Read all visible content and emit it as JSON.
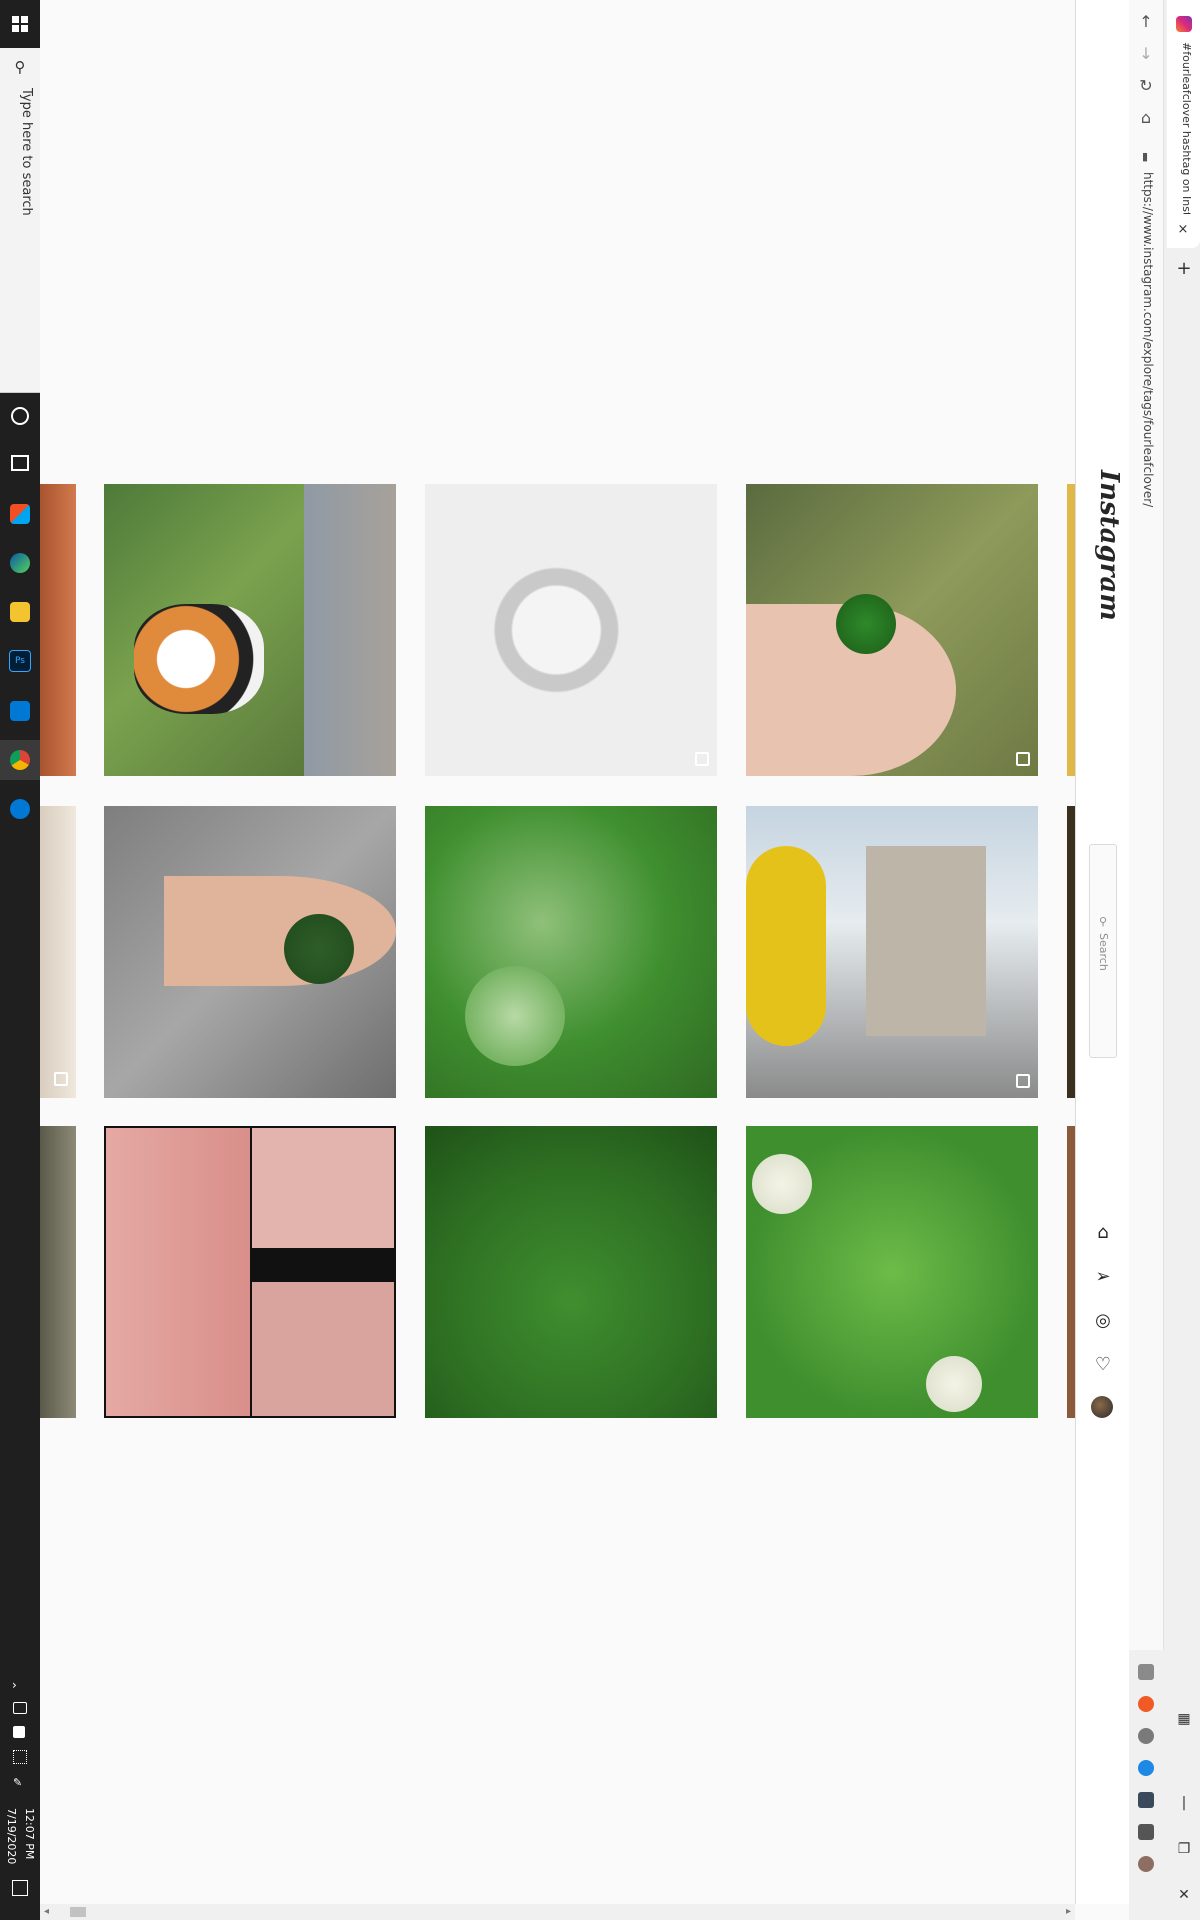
{
  "taskbar": {
    "search_placeholder": "Type here to search",
    "icons": [
      "cortana-icon",
      "task-view-icon",
      "store-icon",
      "edge-icon",
      "file-explorer-icon",
      "photoshop-icon",
      "outlook-icon",
      "chrome-icon",
      "settings-icon"
    ],
    "photoshop_label": "Ps",
    "time": "12:07 PM",
    "date": "7/19/2020"
  },
  "browser": {
    "tab_title": "#fourleafclover hashtag on Insta",
    "url": "https://www.instagram.com/explore/tags/fourleafclover/",
    "new_tab_label": "+",
    "tab_close_label": "×"
  },
  "instagram": {
    "logo": "Instagram",
    "search_placeholder": "Search",
    "nav_icons": [
      "home-icon",
      "direct-icon",
      "explore-icon",
      "activity-icon",
      "profile-avatar"
    ]
  },
  "colors": {
    "taskbar_bg": "#1f1f1f",
    "content_bg": "#fafafa",
    "header_bg": "#ffffff",
    "border": "#dbdbdb",
    "clover_green": "#3f8f2f",
    "tattoo_pink": "#e0a8a8"
  },
  "grid": {
    "tiles": [
      "Cat among wildflowers",
      "Pearl ring",
      "Hand holding four leaf clover",
      "Hand holding clover leaf",
      "Clover patch close-up",
      "Yellow Submarine on street",
      "Tattoo collage",
      "Clover field",
      "Clover with white flowers"
    ]
  }
}
